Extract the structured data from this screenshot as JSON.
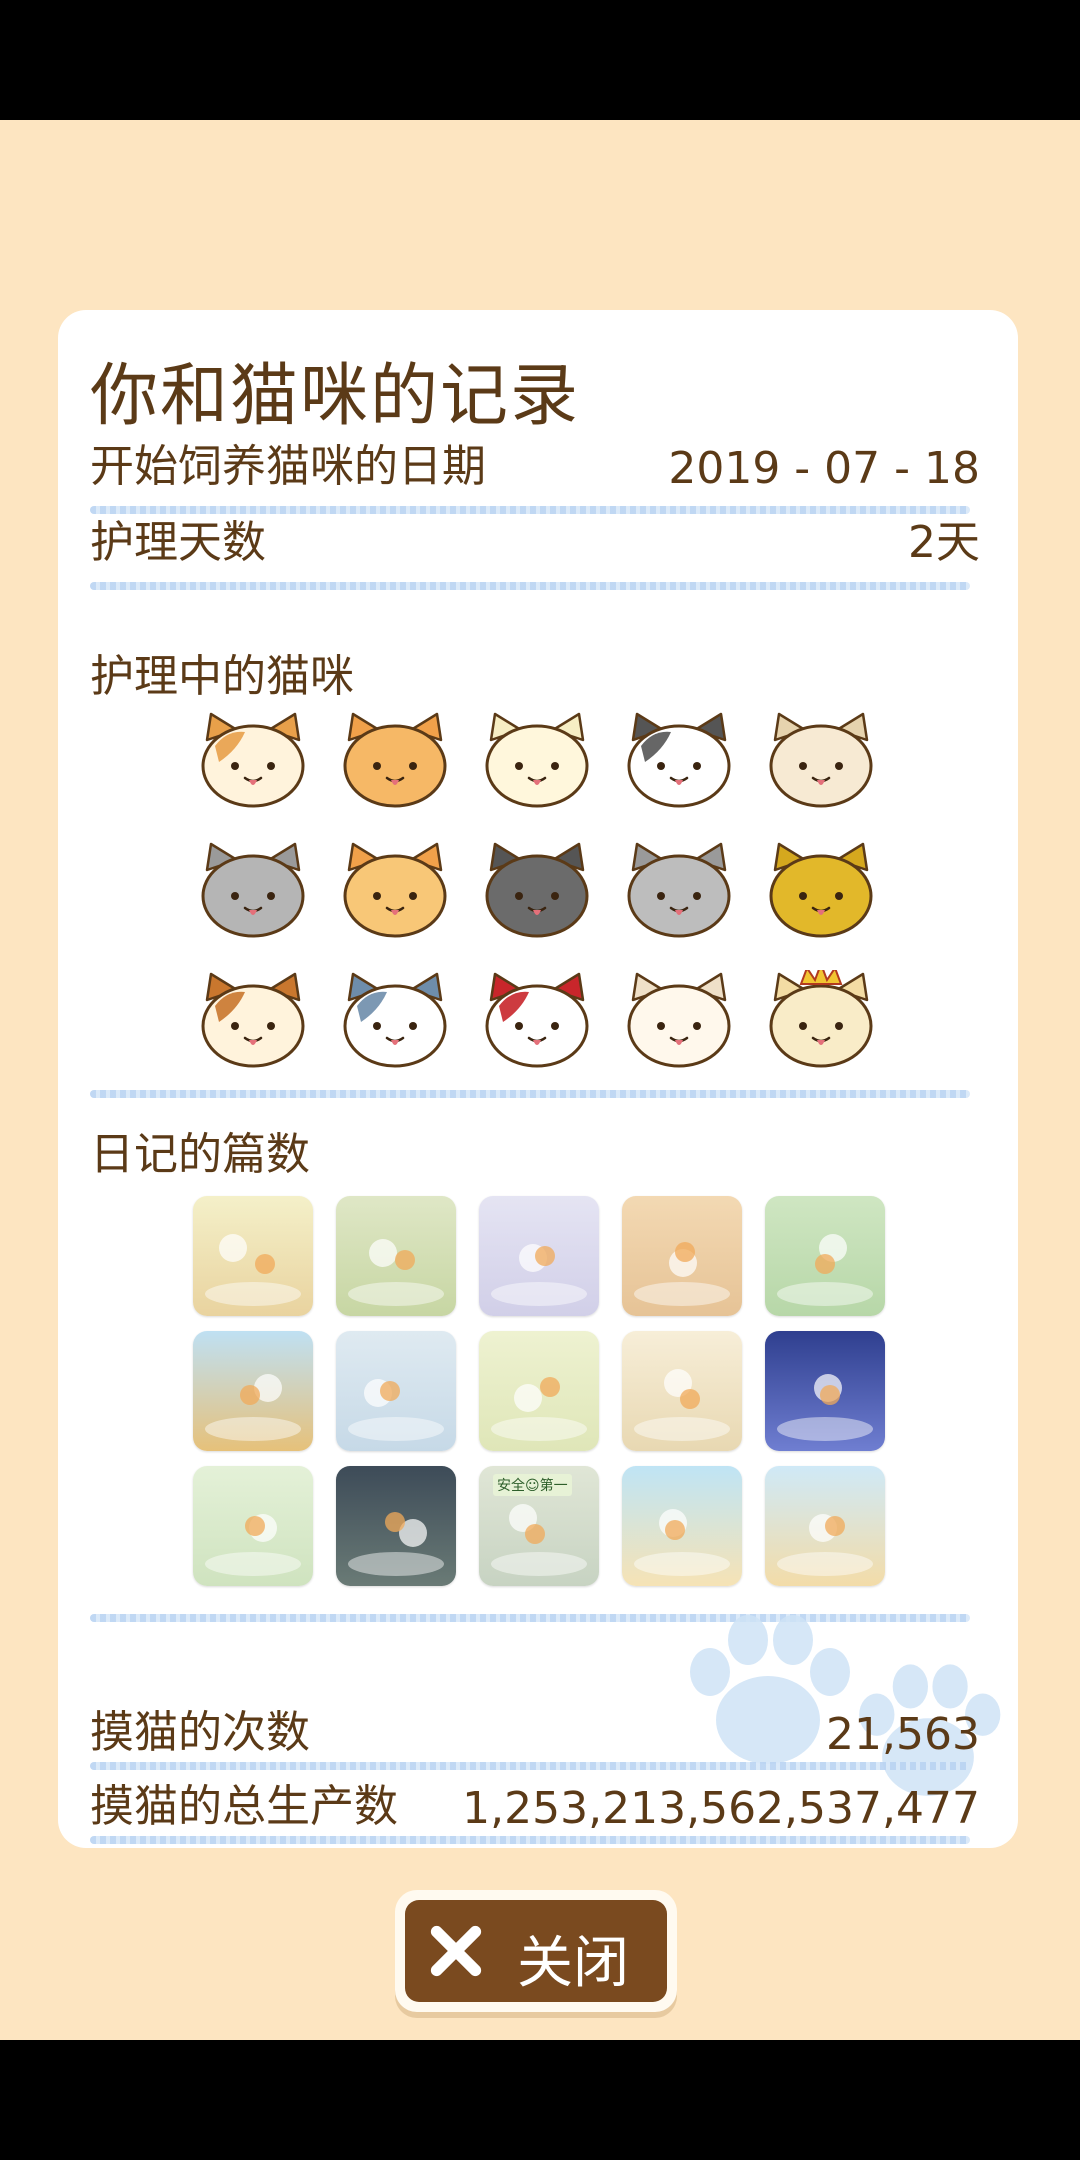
{
  "header": {
    "title": "你和猫咪的记录"
  },
  "stats": {
    "start_label": "开始饲养猫咪的日期",
    "start_value": "2019 - 07 - 18",
    "days_label": "护理天数",
    "days_value": "2天"
  },
  "cats_section": {
    "title": "护理中的猫咪"
  },
  "cats": [
    {
      "name": "calico"
    },
    {
      "name": "orange-tabby"
    },
    {
      "name": "cream"
    },
    {
      "name": "black-white"
    },
    {
      "name": "fluffy-beige"
    },
    {
      "name": "gray-old"
    },
    {
      "name": "orange-small"
    },
    {
      "name": "black"
    },
    {
      "name": "gray-tabby"
    },
    {
      "name": "golden-fluffy"
    },
    {
      "name": "calico-small"
    },
    {
      "name": "blue-white"
    },
    {
      "name": "red-hood"
    },
    {
      "name": "white"
    },
    {
      "name": "king-crown"
    }
  ],
  "diary_section": {
    "title": "日记的篇数"
  },
  "diaries": [
    {
      "name": "paw-hand"
    },
    {
      "name": "two-cats-garden"
    },
    {
      "name": "bed"
    },
    {
      "name": "cat-tower"
    },
    {
      "name": "pond"
    },
    {
      "name": "house"
    },
    {
      "name": "city-towers"
    },
    {
      "name": "tower-antenna"
    },
    {
      "name": "pyramid"
    },
    {
      "name": "rocket-space"
    },
    {
      "name": "bubble-cats"
    },
    {
      "name": "forest-night"
    },
    {
      "name": "safety-first"
    },
    {
      "name": "beach-umbrella"
    },
    {
      "name": "castle"
    }
  ],
  "diary_sign_text": "安全☺第一",
  "pet": {
    "count_label": "摸猫的次数",
    "count_value": "21,563",
    "production_label": "摸猫的总生产数",
    "production_value": "1,253,213,562,537,477"
  },
  "close_button": {
    "label": "关闭",
    "icon": "close-x-icon"
  },
  "colors": {
    "background": "#fde5c1",
    "text": "#5b3a17",
    "button": "#7a4a1f",
    "rule": "#b9d3f2"
  }
}
